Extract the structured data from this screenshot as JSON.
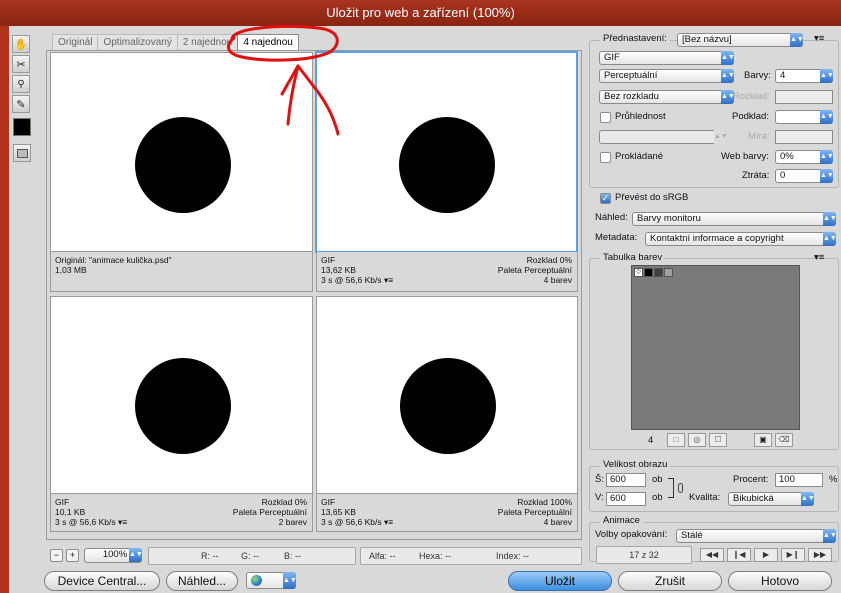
{
  "window": {
    "title": "Uložit pro web a zařízení (100%)"
  },
  "tools": [
    {
      "name": "hand-tool-icon",
      "glyph": "✋"
    },
    {
      "name": "slice-select-tool-icon",
      "glyph": "✂"
    },
    {
      "name": "zoom-tool-icon",
      "glyph": "🔍"
    },
    {
      "name": "eyedropper-tool-icon",
      "glyph": "✎"
    }
  ],
  "tabs": [
    "Originál",
    "Optimalizovaný",
    "2 najednou",
    "4 najednou"
  ],
  "panes": [
    {
      "left": [
        "Originál: \"animace kulička.psd\"",
        "1,03 MB",
        ""
      ],
      "right": [
        "",
        "",
        ""
      ]
    },
    {
      "left": [
        "GIF",
        "13,62 KB",
        "3 s @ 56,6 Kb/s"
      ],
      "right": [
        "Rozklad 0%",
        "Paleta Perceptuální",
        "4 barev"
      ]
    },
    {
      "left": [
        "GIF",
        "10,1 KB",
        "3 s @ 56,6 Kb/s"
      ],
      "right": [
        "Rozklad 0%",
        "Paleta Perceptuální",
        "2 barev"
      ]
    },
    {
      "left": [
        "GIF",
        "13,65 KB",
        "3 s @ 56,6 Kb/s"
      ],
      "right": [
        "Rozklad 100%",
        "Paleta Perceptuální",
        "4 barev"
      ]
    }
  ],
  "status": {
    "zoom": "100%",
    "r": "R: --",
    "g": "G: --",
    "b": "B: --",
    "alpha": "Alfa: --",
    "hexa": "Hexa: --",
    "index": "Index: --"
  },
  "bottom_buttons": {
    "device_central": "Device Central...",
    "preview": "Náhled...",
    "save": "Uložit",
    "cancel": "Zrušit",
    "done": "Hotovo"
  },
  "settings": {
    "preset_label": "Přednastavení:",
    "preset_value": "[Bez názvu]",
    "format": "GIF",
    "reduction": "Perceptuální",
    "colors_label": "Barvy:",
    "colors_value": "4",
    "dither_mode": "Bez rozkladu",
    "dither_label": "Rozklad:",
    "transparency_label": "Průhlednost",
    "matte_label": "Podklad:",
    "amount_label": "Míra:",
    "interlaced_label": "Prokládané",
    "web_snap_label": "Web barvy:",
    "web_snap_value": "0%",
    "lossy_label": "Ztráta:",
    "lossy_value": "0",
    "convert_srgb_label": "Převést do sRGB",
    "preview_label": "Náhled:",
    "preview_value": "Barvy monitoru",
    "metadata_label": "Metadata:",
    "metadata_value": "Kontaktní informace a copyright"
  },
  "color_table": {
    "title": "Tabulka barev",
    "count": "4",
    "swatches": [
      "#ffffff",
      "#000000",
      "#404040",
      "#a0a0a0"
    ]
  },
  "image_size": {
    "title": "Velikost obrazu",
    "w_label": "Š:",
    "w_value": "600",
    "h_label": "V:",
    "h_value": "600",
    "unit": "ob",
    "percent_label": "Procent:",
    "percent_value": "100",
    "percent_sign": "%",
    "quality_label": "Kvalita:",
    "quality_value": "Bikubická"
  },
  "animation": {
    "title": "Animace",
    "loop_label": "Volby opakování:",
    "loop_value": "Stálé",
    "frame": "17 z 32"
  }
}
